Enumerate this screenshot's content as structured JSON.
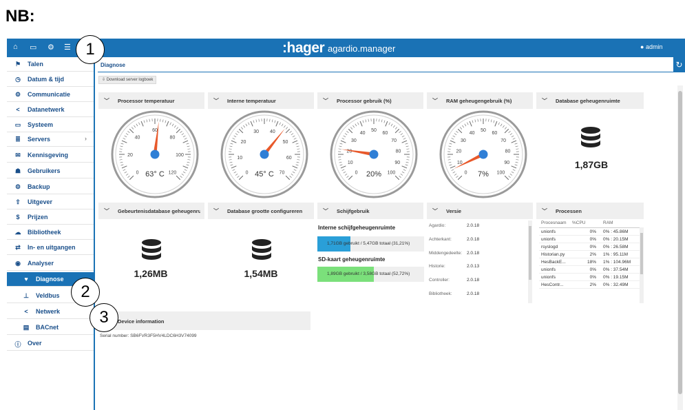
{
  "note_label": "NB:",
  "callouts": [
    "1",
    "2",
    "3"
  ],
  "header": {
    "brand": ":hager",
    "app": "agardio.manager",
    "user": "admin",
    "icons": [
      "home-icon",
      "monitor-icon",
      "gears-icon",
      "sliders-icon"
    ]
  },
  "sidebar": {
    "items": [
      {
        "label": "Talen",
        "icon": "flag-icon",
        "glyph": "⚑"
      },
      {
        "label": "Datum & tijd",
        "icon": "clock-icon",
        "glyph": "◷"
      },
      {
        "label": "Communicatie",
        "icon": "gears-icon",
        "glyph": "⚙"
      },
      {
        "label": "Datanetwerk",
        "icon": "share-icon",
        "glyph": "<"
      },
      {
        "label": "Systeem",
        "icon": "drive-icon",
        "glyph": "▭"
      },
      {
        "label": "Servers",
        "icon": "server-icon",
        "glyph": "≣",
        "chevron": "›"
      },
      {
        "label": "Kennisgeving",
        "icon": "envelope-icon",
        "glyph": "✉"
      },
      {
        "label": "Gebruikers",
        "icon": "users-icon",
        "glyph": "☗"
      },
      {
        "label": "Backup",
        "icon": "gears-icon",
        "glyph": "⚙"
      },
      {
        "label": "Uitgever",
        "icon": "upload-icon",
        "glyph": "⇧"
      },
      {
        "label": "Prijzen",
        "icon": "dollar-icon",
        "glyph": "$"
      },
      {
        "label": "Bibliotheek",
        "icon": "cloud-icon",
        "glyph": "☁"
      },
      {
        "label": "In- en uitgangen",
        "icon": "exchange-icon",
        "glyph": "⇄"
      },
      {
        "label": "Analyser",
        "icon": "eye-icon",
        "glyph": "◉"
      },
      {
        "label": "Diagnose",
        "icon": "heartbeat-icon",
        "glyph": "♥",
        "sub": true,
        "active": true
      },
      {
        "label": "Veldbus",
        "icon": "sitemap-icon",
        "glyph": "⊥",
        "sub": true
      },
      {
        "label": "Netwerk",
        "icon": "share-icon",
        "glyph": "<",
        "sub": true
      },
      {
        "label": "BACnet",
        "icon": "list-icon",
        "glyph": "▤",
        "sub": true
      },
      {
        "label": "Over",
        "icon": "info-icon",
        "glyph": "ⓘ"
      }
    ]
  },
  "breadcrumb": "Diagnose",
  "download_button": "Download server logboek",
  "gauges": [
    {
      "title": "Processor temperatuur",
      "min": 0,
      "max": 120,
      "ticks": [
        "0",
        "20",
        "40",
        "60",
        "80",
        "100",
        "120"
      ],
      "value": 63,
      "label": "63° C"
    },
    {
      "title": "Interne temperatuur",
      "min": 0,
      "max": 70,
      "ticks": [
        "0",
        "10",
        "20",
        "30",
        "40",
        "50",
        "60",
        "70"
      ],
      "value": 45,
      "label": "45° C"
    },
    {
      "title": "Processor gebruik (%)",
      "min": 0,
      "max": 100,
      "ticks": [
        "0",
        "10",
        "20",
        "30",
        "40",
        "50",
        "60",
        "70",
        "80",
        "90",
        "100"
      ],
      "value": 20,
      "label": "20%"
    },
    {
      "title": "RAM geheugengebruik (%)",
      "min": 0,
      "max": 100,
      "ticks": [
        "0",
        "10",
        "20",
        "30",
        "40",
        "50",
        "60",
        "70",
        "80",
        "90",
        "100"
      ],
      "value": 7,
      "label": "7%"
    }
  ],
  "db_memory": {
    "title": "Database geheugenruimte",
    "value": "1,87GB"
  },
  "event_db": {
    "title": "Gebeurtenisdatabase geheugenru...",
    "value": "1,26MB"
  },
  "db_size": {
    "title": "Database grootte configureren",
    "value": "1,54MB"
  },
  "disk": {
    "title": "Schijfgebruik",
    "internal_title": "Interne schijfgeheugenruimte",
    "internal_text": "1,71GB gebruikt / 5,47GB totaal (31,21%)",
    "internal_pct": 31.21,
    "sd_title": "SD-kaart geheugenruimte",
    "sd_text": "1,89GB gebruikt / 3,58GB totaal (52,72%)",
    "sd_pct": 52.72
  },
  "version": {
    "title": "Versie",
    "rows": [
      {
        "label": "Agardio:",
        "value": "2.0.18"
      },
      {
        "label": "Achterkant:",
        "value": "2.0.18"
      },
      {
        "label": "Middengedeelte:",
        "value": "2.0.18"
      },
      {
        "label": "Historie:",
        "value": "2.0.13"
      },
      {
        "label": "Controller:",
        "value": "2.0.18"
      },
      {
        "label": "Bibliotheek:",
        "value": "2.0.18"
      }
    ]
  },
  "processes": {
    "title": "Processen",
    "headers": [
      "Procesnaam",
      "%CPU",
      "RAM"
    ],
    "rows": [
      [
        "unionfs",
        "0%",
        "0% : 45.86M"
      ],
      [
        "unionfs",
        "0%",
        "0% : 20.15M"
      ],
      [
        "rsyslogd",
        "0%",
        "0% : 26.58M"
      ],
      [
        "Historian.py",
        "2%",
        "1% : 95.11M"
      ],
      [
        "HesBackE...",
        "18%",
        "1% : 104.96M"
      ],
      [
        "unionfs",
        "0%",
        "0% : 37.54M"
      ],
      [
        "unionfs",
        "0%",
        "0% : 19.15M"
      ],
      [
        "HesContr...",
        "2%",
        "0% : 32.49M"
      ]
    ]
  },
  "device": {
    "title": "Device information",
    "serial": "Serial number: SB6FVR3F5HV4LDC6H3V74099"
  },
  "colors": {
    "primary": "#1a72b5",
    "needle": "#e8592b",
    "hub": "#2f7fd6",
    "disk_internal": "#2a9fd8",
    "disk_sd": "#7be07b"
  }
}
